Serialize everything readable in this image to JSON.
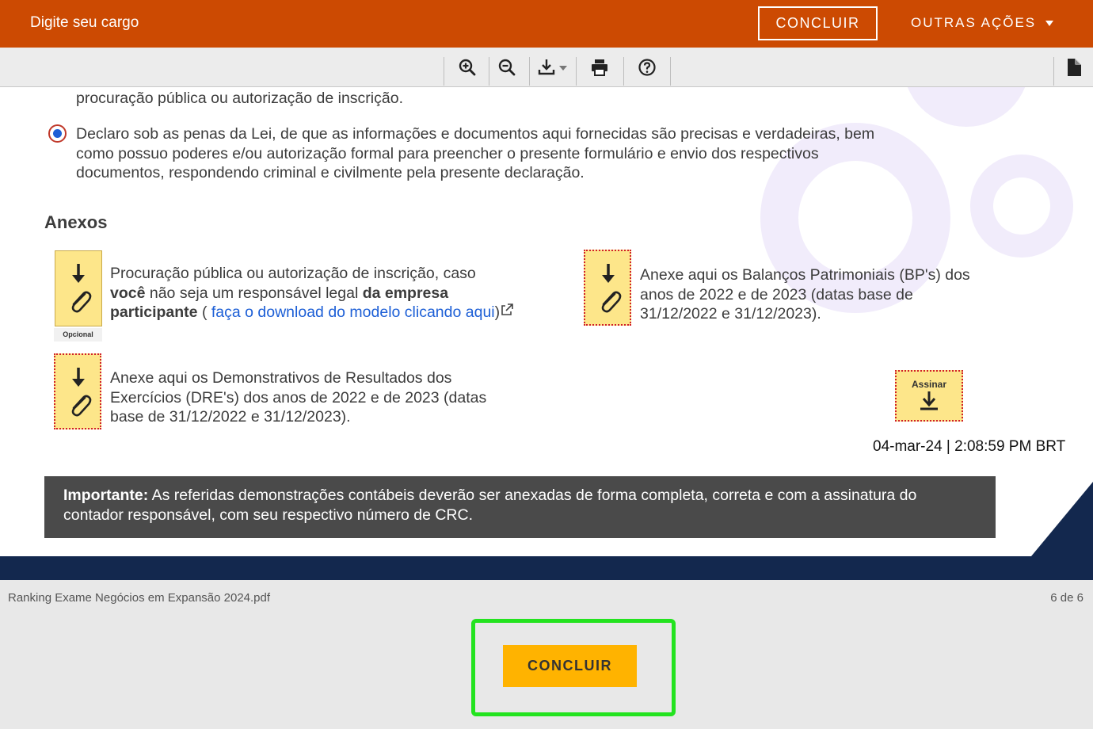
{
  "header": {
    "title_value": "Digite seu cargo",
    "concluir_label": "CONCLUIR",
    "outras_acoes_label": "OUTRAS AÇÕES",
    "bg_color": "#cc4a02"
  },
  "toolbar": {
    "icons": [
      "zoom-in-icon",
      "zoom-out-icon",
      "download-icon",
      "print-icon",
      "help-icon",
      "file-icon"
    ]
  },
  "document": {
    "top_text": "procuração pública ou autorização de inscrição.",
    "declaration": {
      "line1": "Declaro sob as penas da Lei, de que as informações e documentos aqui fornecidas são precisas e verdadeiras, bem",
      "line2": "como possuo poderes e/ou autorização formal para preencher o presente formulário e envio dos respectivos",
      "line3": "documentos, respondendo criminal e civilmente pela presente declaração."
    },
    "anexos_title": "Anexos",
    "attachment1": {
      "line1": "Procuração pública ou autorização de inscrição, caso",
      "line2_bold": "você",
      "line2_rest": " não seja um responsável legal ",
      "line2_bold2": "da empresa",
      "line3_bold": "participante",
      "line3_paren": " ( ",
      "link_text": "faça o download do modelo clicando aqui",
      "line3_end": ")",
      "badge": "Opcional"
    },
    "attachment2": {
      "line1": "Anexe aqui os Balanços Patrimoniais (BP's) dos",
      "line2": "anos de 2022 e de 2023 (datas base de",
      "line3": "31/12/2022 e 31/12/2023)."
    },
    "attachment3": {
      "line1": "Anexe aqui os Demonstrativos de Resultados dos",
      "line2": "Exercícios (DRE's) dos anos de 2022 e de 2023 (datas",
      "line3": "base de 31/12/2022 e 31/12/2023)."
    },
    "sign": {
      "label": "Assinar",
      "timestamp": "04-mar-24 | 2:08:59 PM BRT"
    },
    "important": {
      "bold": "Importante:",
      "text": " As referidas demonstrações contábeis deverão ser anexadas de forma completa, correta e com a assinatura do",
      "line2": "contador responsável, com seu respectivo número de CRC."
    }
  },
  "footer": {
    "filename": "Ranking Exame Negócios em Expansão 2024.pdf",
    "page_count": "6 de 6",
    "concluir_label": "CONCLUIR",
    "accent_color": "#ffb300",
    "highlight_color": "#23e31f"
  }
}
